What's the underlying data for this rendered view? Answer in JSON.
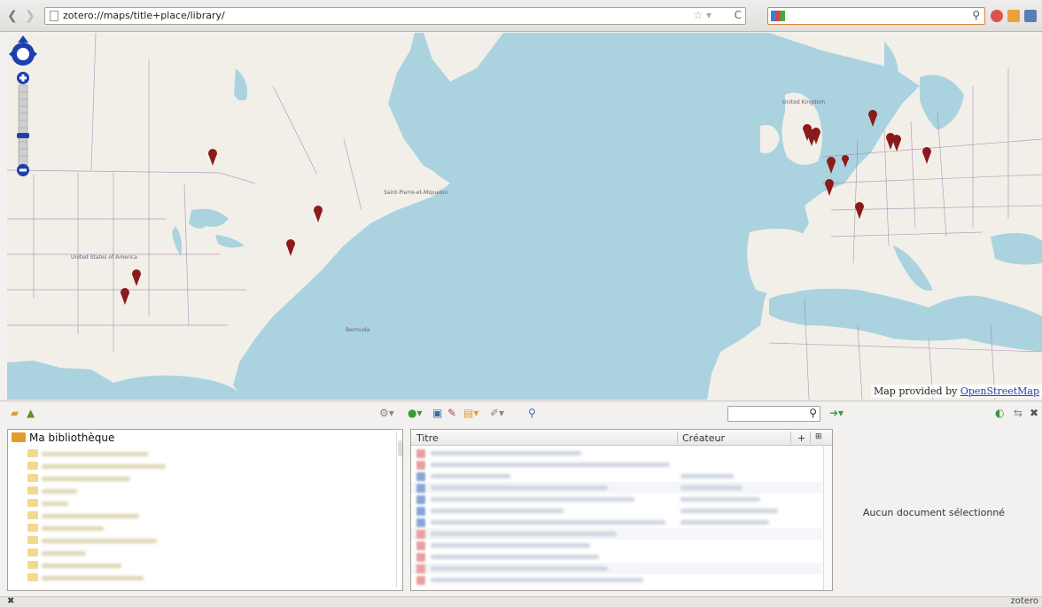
{
  "browser": {
    "url": "zotero://maps/title+place/library/",
    "back_icon": "back-arrow-icon",
    "forward_icon": "forward-arrow-icon",
    "search_placeholder": ""
  },
  "map": {
    "attribution_prefix": "Map provided by ",
    "attribution_link": "OpenStreetMap",
    "labels": {
      "united_states": "United States of America",
      "bermuda": "Bermuda",
      "saint_pierre": "Saint-Pierre-et-Miquelon",
      "united_kingdom": "United Kingdom"
    },
    "marker_count": 16,
    "marker_color": "#8b1a1a"
  },
  "library": {
    "root_label": "Ma bibliothèque",
    "collections_count": 11
  },
  "items": {
    "col_title": "Titre",
    "col_creator": "Créateur",
    "col_plus": "+",
    "row_count": 14
  },
  "detail": {
    "empty_message": "Aucun document sélectionné"
  },
  "status": {
    "close": "✖",
    "brand": "zotero"
  },
  "colors": {
    "water": "#aad3df",
    "land": "#f2efe9",
    "border": "#9b7da8",
    "accent_folder": "#e49c2a"
  }
}
